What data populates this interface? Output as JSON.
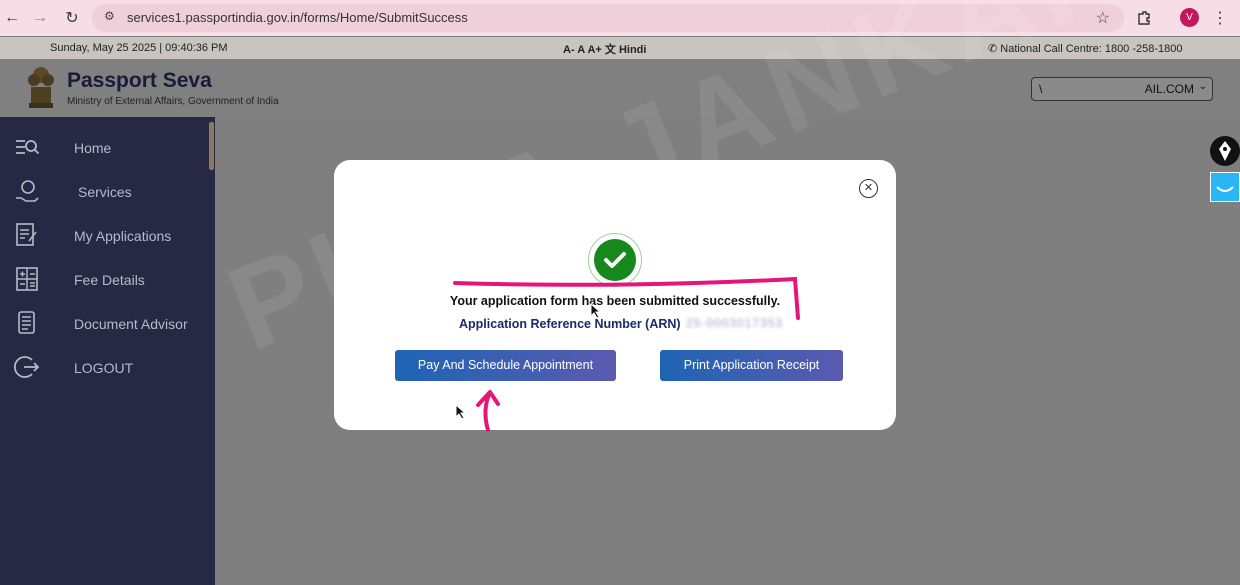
{
  "browser": {
    "url": "services1.passportindia.gov.in/forms/Home/SubmitSuccess",
    "profile_initial": "V"
  },
  "topbar": {
    "datetime": "Sunday, May 25 2025 | 09:40:36 PM",
    "font_controls": "A-  A  A+",
    "language": "Hindi",
    "call_centre": "National Call Centre: 1800 -258-1800"
  },
  "header": {
    "title": "Passport Seva",
    "subtitle": "Ministry of External Affairs, Government of India",
    "user_prefix": "\\",
    "user_suffix": "AIL.COM"
  },
  "sidebar": {
    "items": [
      {
        "label": "Home",
        "icon": "home-menu-icon"
      },
      {
        "label": "Services",
        "icon": "services-icon"
      },
      {
        "label": "My Applications",
        "icon": "applications-icon"
      },
      {
        "label": "Fee Details",
        "icon": "calculator-icon"
      },
      {
        "label": "Document Advisor",
        "icon": "document-icon"
      },
      {
        "label": "LOGOUT",
        "icon": "logout-icon"
      }
    ]
  },
  "modal": {
    "success_message": "Your application form has been submitted successfully.",
    "arn_label": "Application Reference Number (ARN)",
    "arn_value": "25-0003017353",
    "pay_button": "Pay And Schedule Appointment",
    "print_button": "Print Application Receipt"
  },
  "watermark": "PURA JANKARI",
  "colors": {
    "success_green": "#16881c",
    "button_start": "#1e64b4",
    "button_end": "#5a5ab0",
    "annotation_pink": "#e6157a"
  }
}
